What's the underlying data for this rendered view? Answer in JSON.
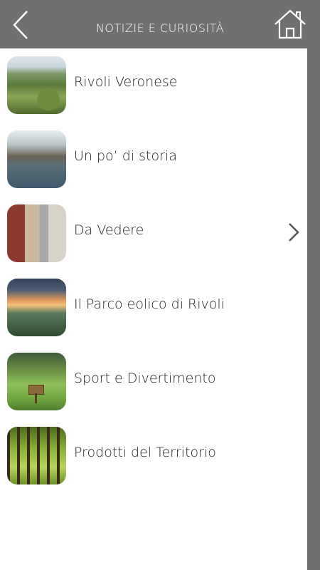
{
  "header": {
    "title": "NOTIZIE E CURIOSITÀ",
    "back_icon": "chevron-left-icon",
    "home_icon": "home-icon"
  },
  "list": {
    "items": [
      {
        "label": "Rivoli Veronese",
        "thumbnail": "village-hillside-photo"
      },
      {
        "label": "Un po’ di storia",
        "thumbnail": "river-valley-photo"
      },
      {
        "label": "Da Vedere",
        "thumbnail": "old-street-houses-photo",
        "chevron_icon": "chevron-right-icon"
      },
      {
        "label": "Il Parco eolico di Rivoli",
        "thumbnail": "wind-farm-sunset-photo"
      },
      {
        "label": "Sport e Divertimento",
        "thumbnail": "meadow-sign-photo"
      },
      {
        "label": "Prodotti del Territorio",
        "thumbnail": "vineyard-photo"
      }
    ]
  },
  "colors": {
    "header_bg": "#707070",
    "content_bg": "#ffffff",
    "text": "#222222"
  }
}
